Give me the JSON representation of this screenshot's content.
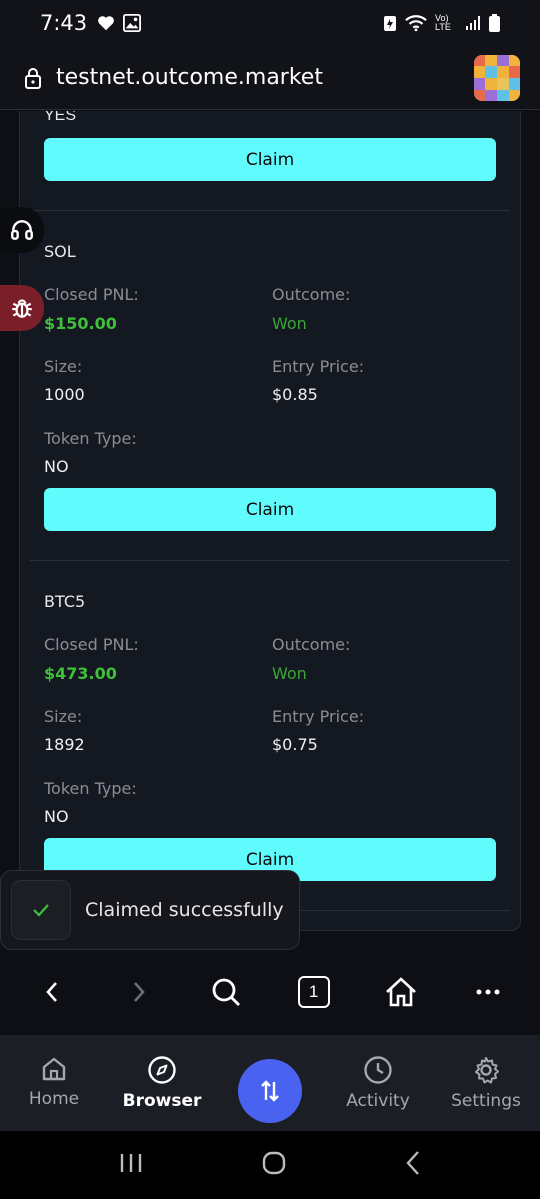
{
  "status": {
    "time": "7:43",
    "network": "Vo) LTE"
  },
  "browser": {
    "url": "testnet.outcome.market",
    "tab_count": "1"
  },
  "content": {
    "partial_token_type": "YES",
    "claim_label": "Claim",
    "labels": {
      "closed_pnl": "Closed PNL:",
      "outcome": "Outcome:",
      "size": "Size:",
      "entry_price": "Entry Price:",
      "token_type": "Token Type:"
    },
    "positions": [
      {
        "name": "SOL",
        "closed_pnl": "$150.00",
        "outcome": "Won",
        "size": "1000",
        "entry_price": "$0.85",
        "token_type": "NO"
      },
      {
        "name": "BTC5",
        "closed_pnl": "$473.00",
        "outcome": "Won",
        "size": "1892",
        "entry_price": "$0.75",
        "token_type": "NO"
      }
    ]
  },
  "toast": {
    "message": "Claimed successfully"
  },
  "app_tabs": [
    {
      "label": "Home",
      "icon": "home-icon"
    },
    {
      "label": "Browser",
      "icon": "compass-icon",
      "active": true
    },
    {
      "label": "",
      "icon": "swap-icon"
    },
    {
      "label": "Activity",
      "icon": "clock-icon"
    },
    {
      "label": "Settings",
      "icon": "gear-icon"
    }
  ],
  "colors": {
    "accent_claim": "#5ffbfd",
    "won_green": "#3fbf3a",
    "swap_button": "#4a62f0",
    "bug_button": "#7a1f2a"
  }
}
